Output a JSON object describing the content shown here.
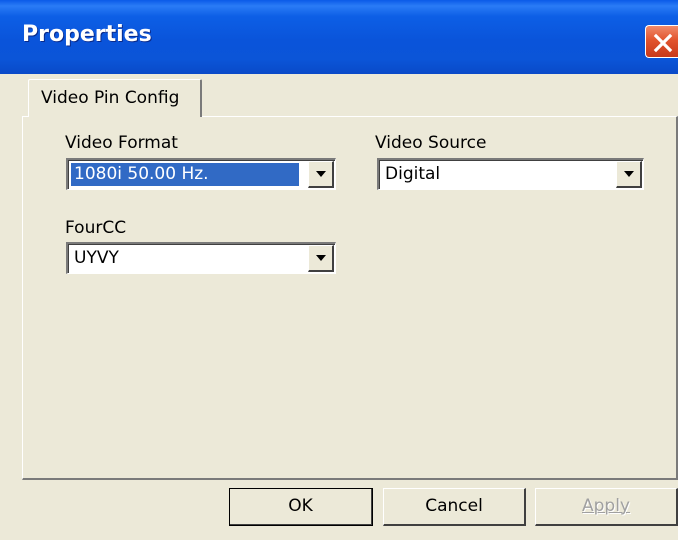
{
  "window": {
    "title": "Properties",
    "close_icon": "close-icon"
  },
  "tabs": [
    {
      "label": "Video Pin Config",
      "selected": true
    }
  ],
  "fields": {
    "video_format": {
      "label": "Video Format",
      "value": "1080i 50.00 Hz.",
      "focused": true
    },
    "video_source": {
      "label": "Video Source",
      "value": "Digital"
    },
    "fourcc": {
      "label": "FourCC",
      "value": "UYVY"
    }
  },
  "buttons": {
    "ok": "OK",
    "cancel": "Cancel",
    "apply": "Apply",
    "apply_enabled": false
  },
  "colors": {
    "titlebar": "#0A54DA",
    "selection": "#316AC5",
    "face": "#ECE9D8",
    "close": "#E2542E"
  }
}
